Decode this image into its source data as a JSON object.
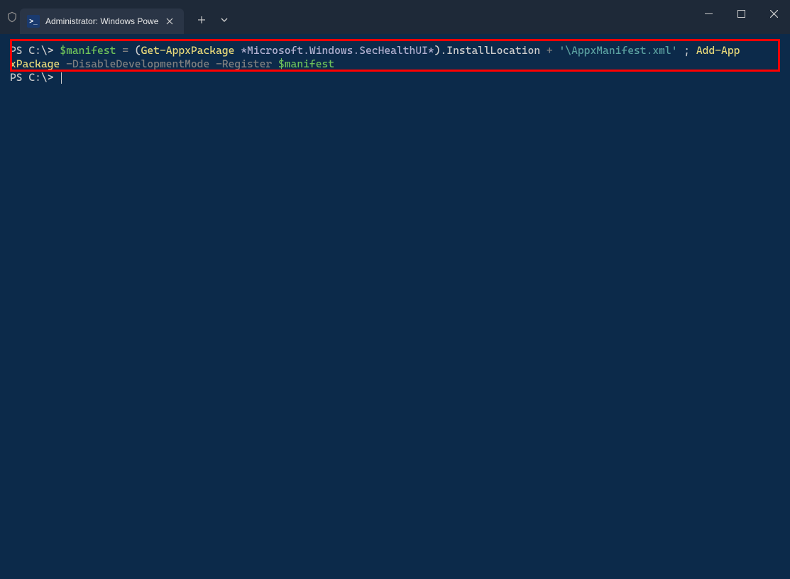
{
  "titlebar": {
    "tab_title": "Administrator: Windows Powe",
    "tab_icon_glyph": ">_"
  },
  "terminal": {
    "prompt1": "PS C:\\> ",
    "line1": {
      "var1": "$manifest",
      "op1": " = ",
      "paren_open": "(",
      "cmd1": "Get-AppxPackage",
      "sp1": " ",
      "arg1": "*Microsoft.Windows.SecHealthUI*",
      "paren_close": ").",
      "prop1": "InstallLocation",
      "sp2": " ",
      "op2": "+",
      "sp3": " ",
      "str1": "'\\AppxManifest.xml'",
      "sp4": " ; ",
      "cmd2a": "Add-App"
    },
    "line2": {
      "cmd2b": "xPackage",
      "sp1": " ",
      "param1": "-DisableDevelopmentMode",
      "sp2": " ",
      "param2": "-Register",
      "sp3": " ",
      "var2": "$manifest"
    },
    "prompt2": "PS C:\\> "
  }
}
